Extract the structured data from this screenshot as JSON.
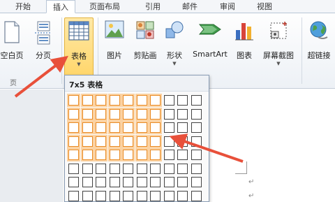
{
  "tabs": [
    {
      "label": "开始",
      "active": false
    },
    {
      "label": "插入",
      "active": true
    },
    {
      "label": "页面布局",
      "active": false
    },
    {
      "label": "引用",
      "active": false
    },
    {
      "label": "邮件",
      "active": false
    },
    {
      "label": "审阅",
      "active": false
    },
    {
      "label": "视图",
      "active": false
    }
  ],
  "ribbon": {
    "buttons": {
      "blank_page": "空白页",
      "page_break": "分页",
      "table": "表格",
      "picture": "图片",
      "clipart": "剪贴画",
      "shapes": "形状",
      "smartart": "SmartArt",
      "chart": "图表",
      "screenshot": "屏幕截图",
      "hyperlink": "超链接"
    },
    "groups": {
      "pages": "页"
    }
  },
  "table_popup": {
    "title": "7x5 表格",
    "grid_cols": 10,
    "grid_rows": 8,
    "selected_cols": 7,
    "selected_rows": 5
  },
  "colors": {
    "selection_border": "#e98a23",
    "arrow": "#e8503a",
    "button_highlight": "#ffd66b"
  }
}
